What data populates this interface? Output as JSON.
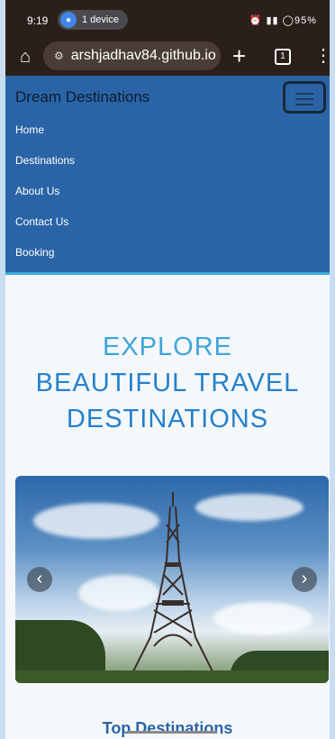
{
  "status_bar": {
    "time": "9:19",
    "device_label": "1 device",
    "battery": "95%"
  },
  "browser": {
    "url": "arshjadhav84.github.io",
    "tab_count": "1"
  },
  "navbar": {
    "brand": "Dream Destinations",
    "links": [
      "Home",
      "Destinations",
      "About Us",
      "Contact Us",
      "Booking"
    ]
  },
  "hero": {
    "line1": "EXPLORE",
    "line2": "BEAUTIFUL TRAVEL",
    "line3": "DESTINATIONS"
  },
  "carousel": {
    "prev_glyph": "‹",
    "next_glyph": "›"
  },
  "section": {
    "title": "Top Destinations"
  },
  "colors": {
    "navbar_bg": "#2a64a6",
    "hero_text": "#2580cc",
    "browser_chrome": "#2b1f1a"
  }
}
